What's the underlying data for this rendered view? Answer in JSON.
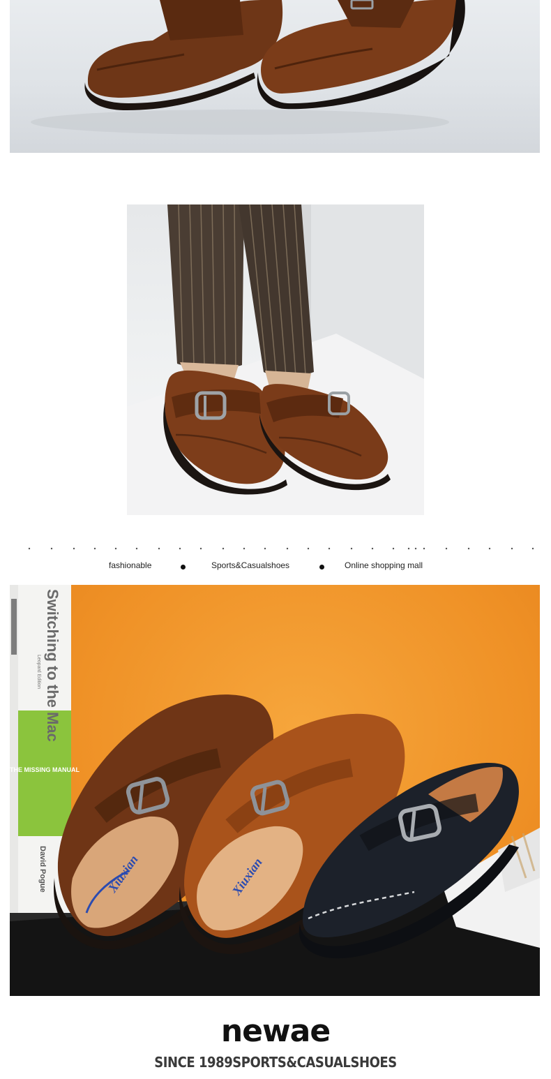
{
  "colors": {
    "brown_leather": "#7a3f1e",
    "tan_leather": "#b25a1f",
    "black_leather": "#1b1f26",
    "orange_background": "#f09a2e",
    "book_green": "#8ac43f"
  },
  "product_photos": [
    {
      "subject": "brown-shoes-closeup"
    },
    {
      "subject": "child-wearing-brown-shoes"
    },
    {
      "subject": "three-shoes-orange-background"
    }
  ],
  "book_prop": {
    "title": "Switching to the Mac",
    "edition": "Leopard Edition",
    "series": "THE MISSING MANUAL",
    "author": "David Pogue"
  },
  "insole_brand": "Xiuxian",
  "taglines": {
    "left": "fashionable",
    "center": "Sports&Casualshoes",
    "right": "Online shopping mall"
  },
  "brand": {
    "name": "newae",
    "slogan": "SINCE 1989SPORTS&CASUALSHOES"
  }
}
